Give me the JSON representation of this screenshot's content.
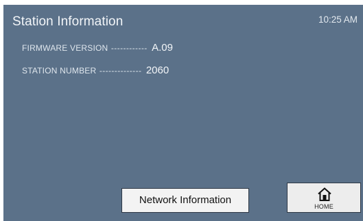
{
  "screen": {
    "title": "Station Information",
    "time": "10:25 AM"
  },
  "info": {
    "firmware": {
      "label": "FIRMWARE VERSION",
      "dashes": "------------",
      "value": "A.09"
    },
    "station": {
      "label": "STATION NUMBER",
      "dashes": "--------------",
      "value": "2060"
    }
  },
  "buttons": {
    "network_label": "Network Information",
    "home_label": "HOME",
    "home_icon": "home-icon"
  },
  "colors": {
    "background": "#5b7189",
    "button": "#f3f3f3",
    "text_light": "#f2f5f8"
  }
}
